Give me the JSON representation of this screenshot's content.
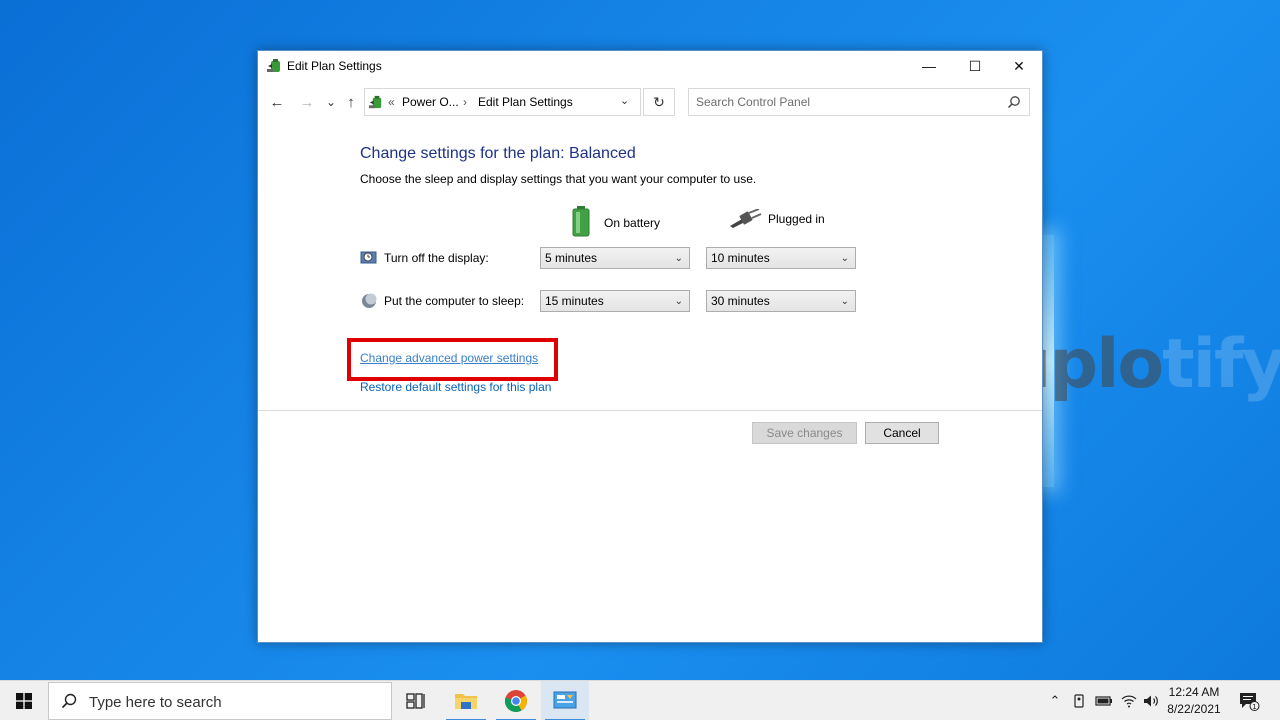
{
  "window": {
    "title": "Edit Plan Settings",
    "minimize_glyph": "—",
    "maximize_glyph": "☐",
    "close_glyph": "✕"
  },
  "navigation": {
    "back_glyph": "←",
    "forward_glyph": "→",
    "recent_glyph": "⌄",
    "up_glyph": "↑",
    "crumb_separator_start": "«",
    "breadcrumbs": [
      "Power O...",
      "Edit Plan Settings"
    ],
    "crumb_separator": "›",
    "dropdown_glyph": "⌄",
    "refresh_glyph": "↻"
  },
  "search": {
    "placeholder": "Search Control Panel"
  },
  "content": {
    "heading": "Change settings for the plan: Balanced",
    "subtext": "Choose the sleep and display settings that you want your computer to use.",
    "col_battery": "On battery",
    "col_plugged": "Plugged in",
    "rows": [
      {
        "label": "Turn off the display:",
        "battery": "5 minutes",
        "plugged": "10 minutes"
      },
      {
        "label": "Put the computer to sleep:",
        "battery": "15 minutes",
        "plugged": "30 minutes"
      }
    ],
    "chevron_glyph": "⌄",
    "link_advanced": "Change advanced power settings",
    "link_restore": "Restore default settings for this plan",
    "save_label": "Save changes",
    "cancel_label": "Cancel"
  },
  "watermark": {
    "text_dark": "uplo",
    "text_light": "tify"
  },
  "taskbar": {
    "search_text": "Type here to search",
    "time": "12:24 AM",
    "date": "8/22/2021",
    "tray_chevron": "⌃",
    "notification_count": "1"
  },
  "colors": {
    "heading": "#1e3287",
    "link": "#0b62b8",
    "highlight": "#e00000",
    "desktop": "#1583e6"
  }
}
